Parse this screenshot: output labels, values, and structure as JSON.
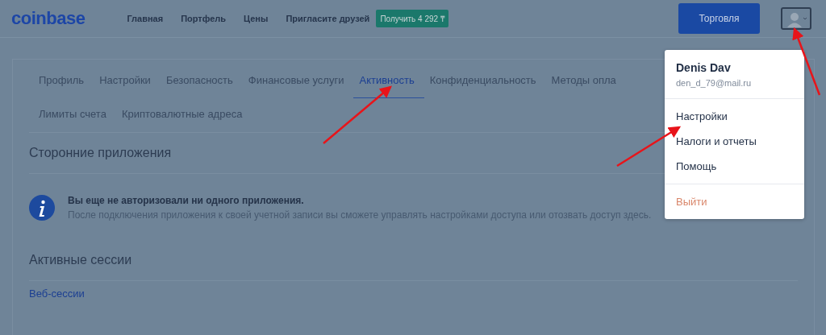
{
  "header": {
    "logo": "coinbase",
    "nav": [
      {
        "label": "Главная"
      },
      {
        "label": "Портфель"
      },
      {
        "label": "Цены"
      },
      {
        "label": "Пригласите друзей"
      }
    ],
    "promo_badge": "Получить 4 292 ₸",
    "trade_button": "Торговля"
  },
  "tabs": [
    {
      "label": "Профиль",
      "selected": false
    },
    {
      "label": "Настройки",
      "selected": false
    },
    {
      "label": "Безопасность",
      "selected": false
    },
    {
      "label": "Финансовые услуги",
      "selected": false
    },
    {
      "label": "Активность",
      "selected": true
    },
    {
      "label": "Конфиденциальность",
      "selected": false
    },
    {
      "label": "Методы опла",
      "selected": false
    },
    {
      "label": "Лимиты счета",
      "selected": false
    },
    {
      "label": "Криптовалютные адреса",
      "selected": false
    }
  ],
  "third_party_apps": {
    "title": "Сторонние приложения",
    "notice_title": "Вы еще не авторизовали ни одного приложения.",
    "notice_text": "После подключения приложения к своей учетной записи вы сможете управлять настройками доступа или отозвать доступ здесь."
  },
  "active_sessions": {
    "title": "Активные сессии",
    "link": "Веб-сессии"
  },
  "user_menu": {
    "name": "Denis Dav",
    "email": "den_d_79@mail.ru",
    "items": [
      {
        "label": "Настройки",
        "kind": "normal"
      },
      {
        "label": "Налоги и отчеты",
        "kind": "normal"
      },
      {
        "label": "Помощь",
        "kind": "normal"
      },
      {
        "label": "Выйти",
        "kind": "danger"
      }
    ]
  }
}
